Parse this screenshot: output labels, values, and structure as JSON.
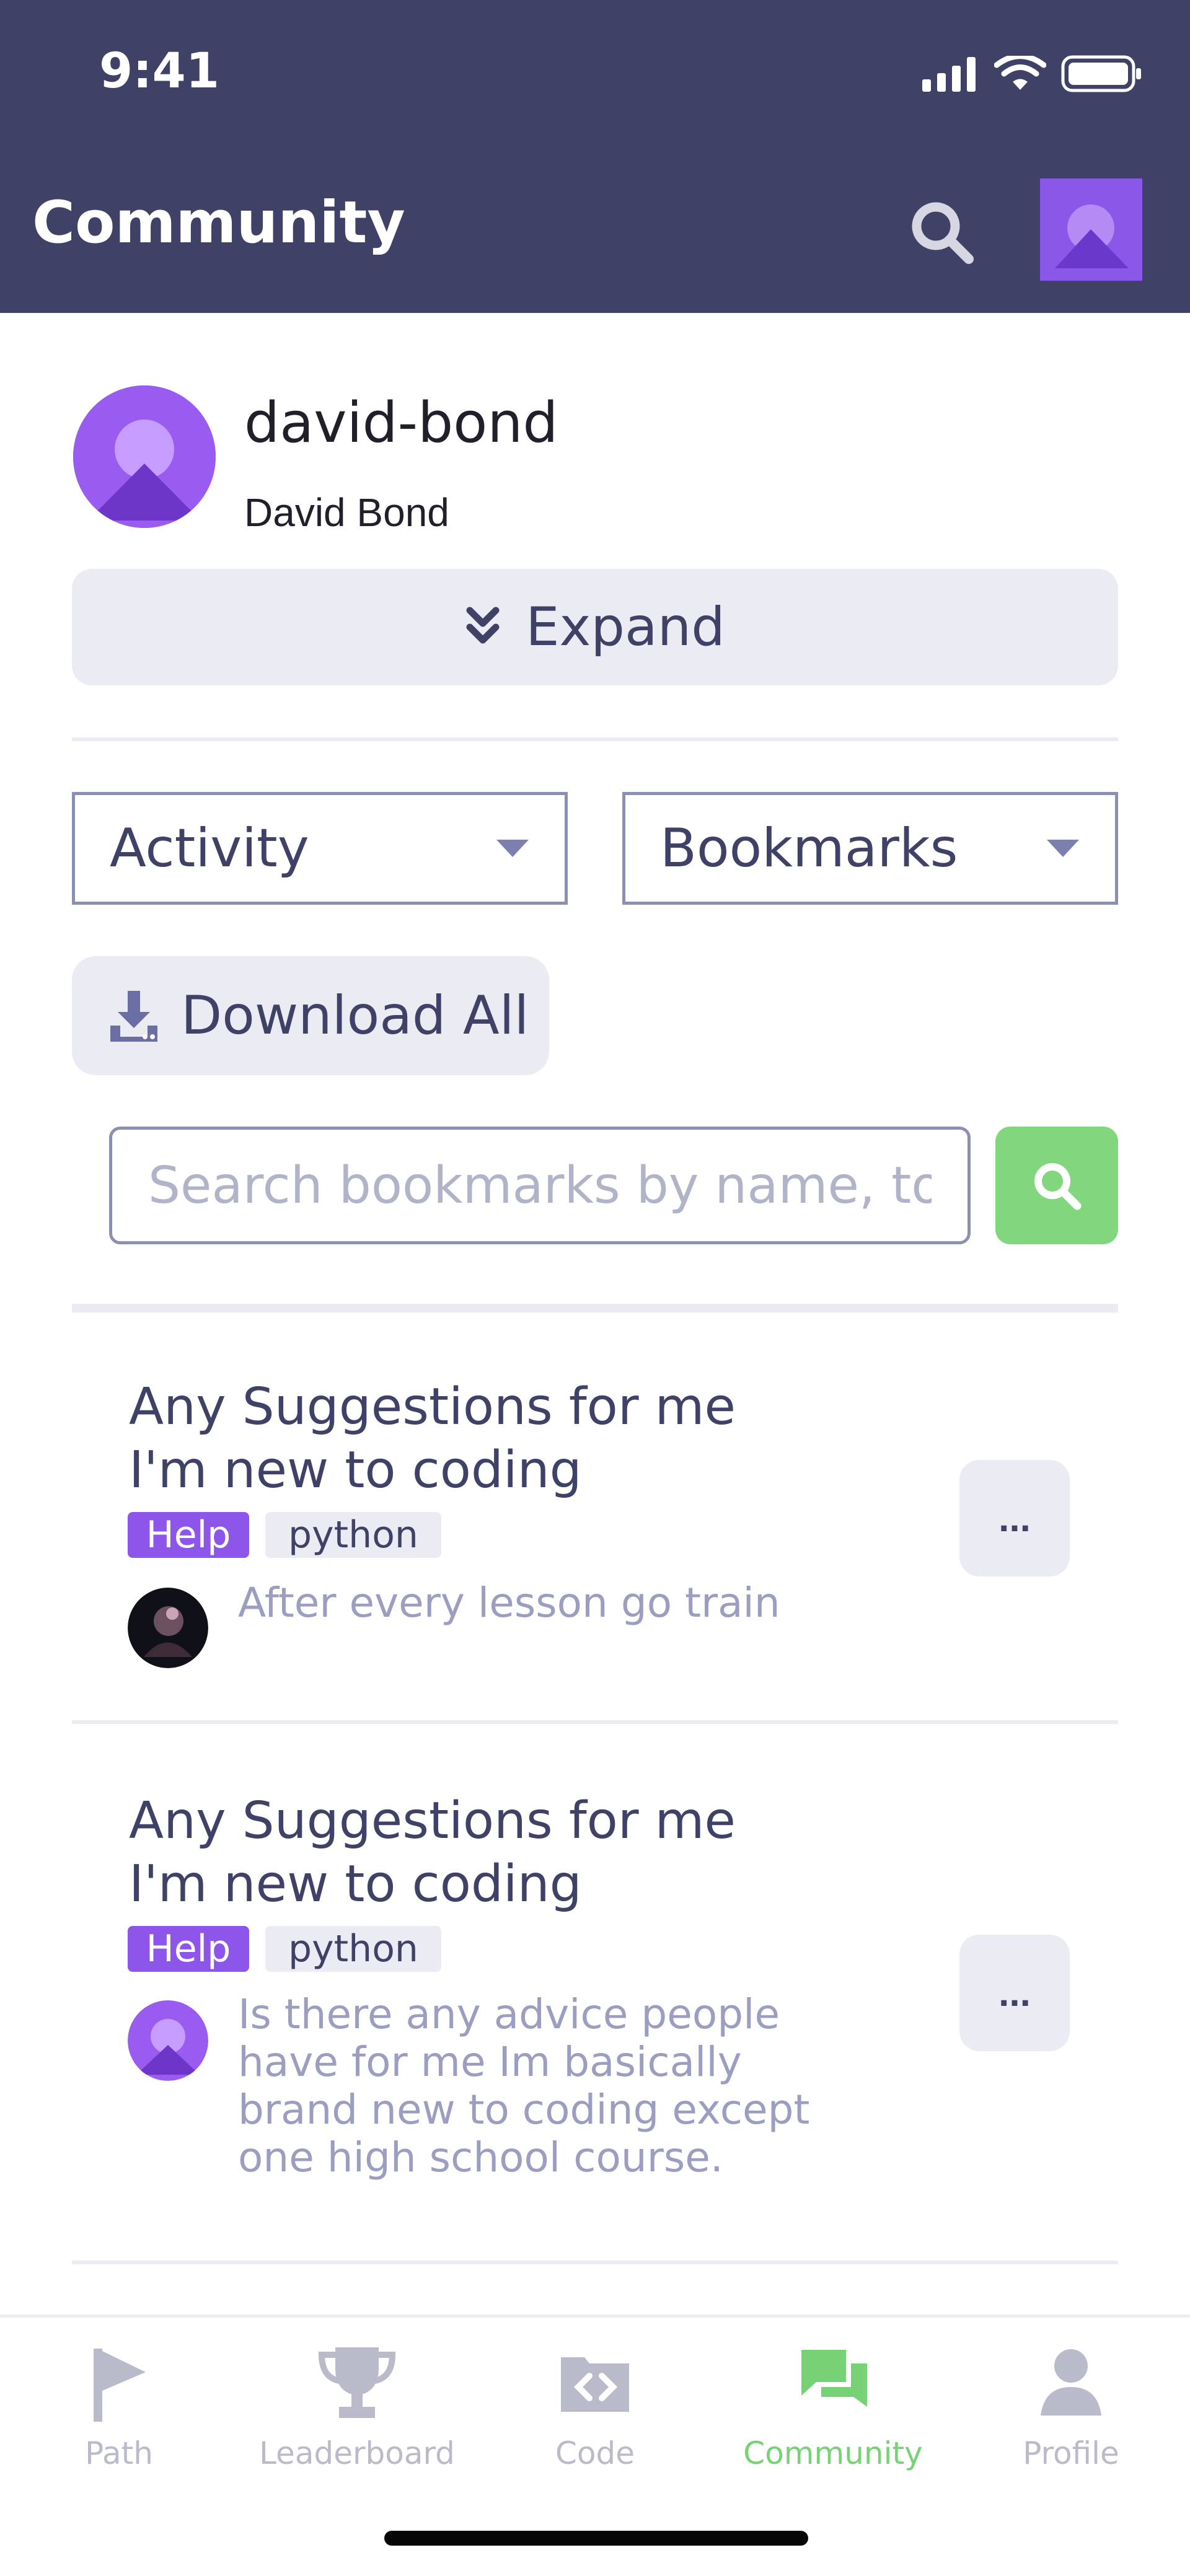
{
  "status_bar": {
    "time": "9:41"
  },
  "header": {
    "title": "Community",
    "search_icon": "search-icon",
    "avatar_icon": "avatar-icon"
  },
  "profile": {
    "username": "david-bond",
    "full_name": "David Bond",
    "expand_label": "Expand",
    "expand_icon": "chevron-down-icon"
  },
  "filters": {
    "activity_select": "Activity",
    "bookmarks_select": "Bookmarks"
  },
  "download": {
    "label": "Download All",
    "icon": "download-icon"
  },
  "search": {
    "placeholder": "Search bookmarks by name, to",
    "icon": "search-icon"
  },
  "items": [
    {
      "title_line_1": "Any Suggestions for me",
      "title_line_2": "I'm new to coding",
      "tags": [
        "Help",
        "python"
      ],
      "excerpt": "After every lesson go train",
      "menu_label": "..."
    },
    {
      "title_line_1": "Any Suggestions for me",
      "title_line_2": "I'm new to coding",
      "tags": [
        "Help",
        "python"
      ],
      "excerpt_lines": [
        "Is there any advice people",
        "have for me Im basically",
        "brand new to coding except",
        "one high school course."
      ],
      "menu_label": "..."
    }
  ],
  "tabs": [
    {
      "label": "Path",
      "icon": "flag-icon"
    },
    {
      "label": "Leaderboard",
      "icon": "trophy-icon"
    },
    {
      "label": "Code",
      "icon": "code-icon"
    },
    {
      "label": "Community",
      "icon": "chat-icon"
    },
    {
      "label": "Profile",
      "icon": "profile-icon"
    }
  ],
  "colors": {
    "header": "#3f4167",
    "accent_green": "#82d77e",
    "help_tag": "#8d55ea",
    "inactive_tab": "#b9bbca"
  }
}
